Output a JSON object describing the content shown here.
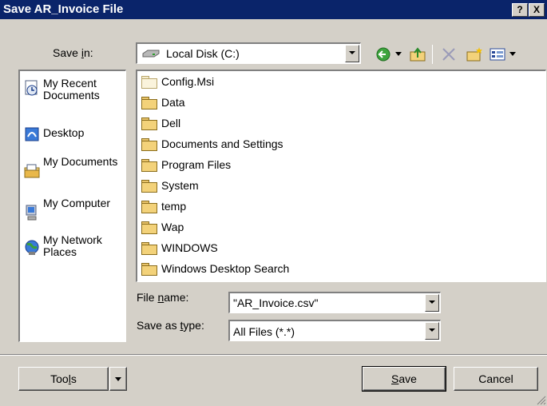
{
  "window": {
    "title": "Save AR_Invoice File",
    "help_label": "?",
    "close_label": "X"
  },
  "save_in": {
    "label": "Save in:",
    "label_pre": "Save ",
    "label_u": "i",
    "label_post": "n:",
    "value": "Local Disk (C:)"
  },
  "places": [
    {
      "icon": "recent-documents-icon",
      "label": "My Recent Documents"
    },
    {
      "icon": "desktop-icon",
      "label": "Desktop"
    },
    {
      "icon": "my-documents-icon",
      "label": "My Documents"
    },
    {
      "icon": "my-computer-icon",
      "label": "My Computer"
    },
    {
      "icon": "my-network-places-icon",
      "label": "My Network Places"
    }
  ],
  "files": [
    "Config.Msi",
    "Data",
    "Dell",
    "Documents and Settings",
    "Program Files",
    "System",
    "temp",
    "Wap",
    "WINDOWS",
    "Windows Desktop Search"
  ],
  "file_name": {
    "label_pre": "File ",
    "label_u": "n",
    "label_post": "ame:",
    "value": "\"AR_Invoice.csv\""
  },
  "save_type": {
    "label_pre": "Save as ",
    "label_u": "t",
    "label_post": "ype:",
    "value": "All Files (*.*)"
  },
  "buttons": {
    "tools_pre": "Too",
    "tools_u": "l",
    "tools_post": "s",
    "save_u": "S",
    "save_post": "ave",
    "cancel": "Cancel"
  },
  "colors": {
    "titlebar": "#0a246a",
    "face": "#d4d0c8",
    "folder": "#f3d27a"
  }
}
